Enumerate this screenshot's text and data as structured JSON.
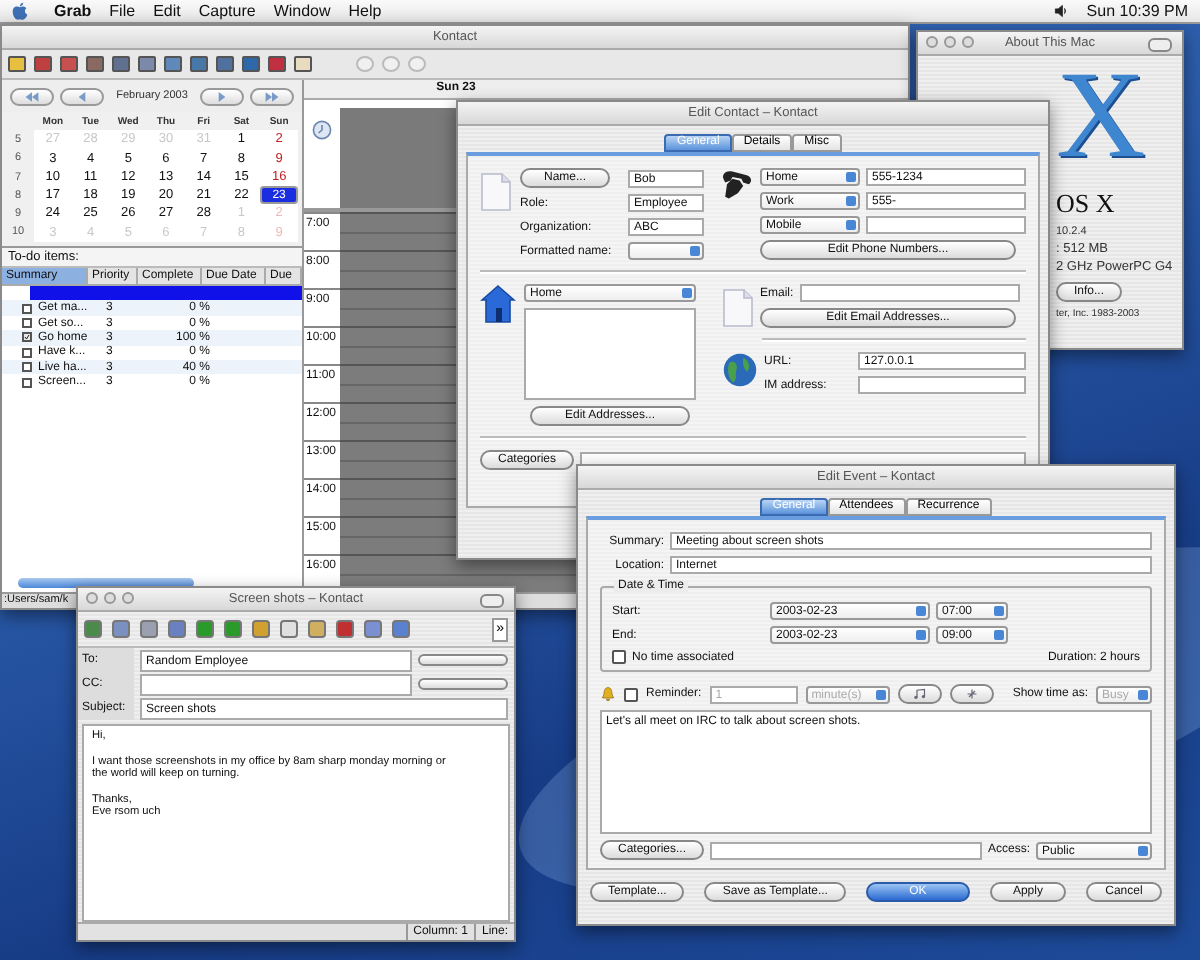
{
  "menubar": {
    "app": "Grab",
    "items": [
      "File",
      "Edit",
      "Capture",
      "Window",
      "Help"
    ],
    "clock": "Sun 10:39 PM"
  },
  "kontact": {
    "title": "Kontact",
    "calendar": {
      "month": "February 2003",
      "weekdays": [
        "Mon",
        "Tue",
        "Wed",
        "Thu",
        "Fri",
        "Sat",
        "Sun"
      ],
      "weeks": [
        {
          "week": "5",
          "days": [
            {
              "n": "27",
              "dim": true,
              "selected": false
            },
            {
              "n": "28",
              "dim": true,
              "selected": false
            },
            {
              "n": "29",
              "dim": true,
              "selected": false
            },
            {
              "n": "30",
              "dim": true,
              "selected": false
            },
            {
              "n": "31",
              "dim": true,
              "selected": false
            },
            {
              "n": "1",
              "dim": false,
              "selected": false
            },
            {
              "n": "2",
              "dim": false,
              "selected": false
            }
          ]
        },
        {
          "week": "6",
          "days": [
            {
              "n": "3",
              "dim": false,
              "selected": false
            },
            {
              "n": "4",
              "dim": false,
              "selected": false
            },
            {
              "n": "5",
              "dim": false,
              "selected": false
            },
            {
              "n": "6",
              "dim": false,
              "selected": false
            },
            {
              "n": "7",
              "dim": false,
              "selected": false
            },
            {
              "n": "8",
              "dim": false,
              "selected": false
            },
            {
              "n": "9",
              "dim": false,
              "selected": false
            }
          ]
        },
        {
          "week": "7",
          "days": [
            {
              "n": "10",
              "dim": false,
              "selected": false
            },
            {
              "n": "11",
              "dim": false,
              "selected": false
            },
            {
              "n": "12",
              "dim": false,
              "selected": false
            },
            {
              "n": "13",
              "dim": false,
              "selected": false
            },
            {
              "n": "14",
              "dim": false,
              "selected": false
            },
            {
              "n": "15",
              "dim": false,
              "selected": false
            },
            {
              "n": "16",
              "dim": false,
              "selected": false
            }
          ]
        },
        {
          "week": "8",
          "days": [
            {
              "n": "17",
              "dim": false,
              "selected": false
            },
            {
              "n": "18",
              "dim": false,
              "selected": false
            },
            {
              "n": "19",
              "dim": false,
              "selected": false
            },
            {
              "n": "20",
              "dim": false,
              "selected": false
            },
            {
              "n": "21",
              "dim": false,
              "selected": false
            },
            {
              "n": "22",
              "dim": false,
              "selected": false
            },
            {
              "n": "23",
              "dim": false,
              "selected": true
            }
          ]
        },
        {
          "week": "9",
          "days": [
            {
              "n": "24",
              "dim": false,
              "selected": false
            },
            {
              "n": "25",
              "dim": false,
              "selected": false
            },
            {
              "n": "26",
              "dim": false,
              "selected": false
            },
            {
              "n": "27",
              "dim": false,
              "selected": false
            },
            {
              "n": "28",
              "dim": false,
              "selected": false
            },
            {
              "n": "1",
              "dim": true,
              "selected": false
            },
            {
              "n": "2",
              "dim": true,
              "selected": false
            }
          ]
        },
        {
          "week": "10",
          "days": [
            {
              "n": "3",
              "dim": true,
              "selected": false
            },
            {
              "n": "4",
              "dim": true,
              "selected": false
            },
            {
              "n": "5",
              "dim": true,
              "selected": false
            },
            {
              "n": "6",
              "dim": true,
              "selected": false
            },
            {
              "n": "7",
              "dim": true,
              "selected": false
            },
            {
              "n": "8",
              "dim": true,
              "selected": false
            },
            {
              "n": "9",
              "dim": true,
              "selected": false
            }
          ]
        }
      ]
    },
    "todo": {
      "title": "To-do items:",
      "columns": [
        "Summary",
        "Priority",
        "Complete",
        "Due Date",
        "Due"
      ],
      "rows": [
        {
          "selected": true
        },
        {
          "selected": false,
          "done": false,
          "summary": "Get ma...",
          "priority": "3",
          "complete": "0 %"
        },
        {
          "selected": false,
          "done": false,
          "summary": "Get so...",
          "priority": "3",
          "complete": "0 %"
        },
        {
          "selected": false,
          "done": true,
          "summary": "Go home",
          "priority": "3",
          "complete": "100 %"
        },
        {
          "selected": false,
          "done": false,
          "summary": "Have k...",
          "priority": "3",
          "complete": "0 %"
        },
        {
          "selected": false,
          "done": false,
          "summary": "Live ha...",
          "priority": "3",
          "complete": "40 %"
        },
        {
          "selected": false,
          "done": false,
          "summary": "Screen...",
          "priority": "3",
          "complete": "0 %"
        }
      ]
    },
    "day": {
      "header": "Sun 23",
      "hours": [
        "7:00",
        "8:00",
        "9:00",
        "10:00",
        "11:00",
        "12:00",
        "13:00",
        "14:00",
        "15:00",
        "16:00"
      ]
    },
    "path": ":Users/sam/k"
  },
  "about": {
    "title": "About This Mac",
    "logo": "X",
    "os": "OS X",
    "version": "10.2.4",
    "memory": ": 512 MB",
    "processor": "2 GHz PowerPC G4",
    "more_info": "Info...",
    "copyright": "ter, Inc. 1983-2003"
  },
  "contact": {
    "title": "Edit Contact – Kontact",
    "tabs": [
      {
        "label": "General",
        "selected": true
      },
      {
        "label": "Details",
        "selected": false
      },
      {
        "label": "Misc",
        "selected": false
      }
    ],
    "name_button": "Name...",
    "name": "Bob",
    "fields": [
      {
        "label": "Role:",
        "value": "Employee"
      },
      {
        "label": "Organization:",
        "value": "ABC"
      }
    ],
    "formatted_name_label": "Formatted name:",
    "phones": [
      {
        "type": "Home",
        "number": "555-1234"
      },
      {
        "type": "Work",
        "number": "555-"
      },
      {
        "type": "Mobile"
      }
    ],
    "edit_phones": "Edit Phone Numbers...",
    "address_type": "Home",
    "edit_addresses": "Edit Addresses...",
    "email_label": "Email:",
    "edit_emails": "Edit Email Addresses...",
    "url_label": "URL:",
    "url": "127.0.0.1",
    "im_label": "IM address:",
    "categories": "Categories"
  },
  "event": {
    "title": "Edit Event – Kontact",
    "tabs": [
      {
        "label": "General",
        "selected": true
      },
      {
        "label": "Attendees",
        "selected": false
      },
      {
        "label": "Recurrence",
        "selected": false
      }
    ],
    "summary_label": "Summary:",
    "summary": "Meeting about screen shots",
    "location_label": "Location:",
    "location": "Internet",
    "group": "Date & Time",
    "start_label": "Start:",
    "start_date": "2003-02-23",
    "start_time": "07:00",
    "end_label": "End:",
    "end_date": "2003-02-23",
    "end_time": "09:00",
    "no_time": {
      "label": "No time associated",
      "checked": false
    },
    "duration": "Duration: 2 hours",
    "reminder": {
      "label": "Reminder:",
      "checked": false,
      "value": "1",
      "unit": "minute(s)"
    },
    "show_time_label": "Show time as:",
    "show_time": "Busy",
    "description": "Let's all meet on IRC to talk about screen shots.",
    "categories": "Categories...",
    "access_label": "Access:",
    "access": "Public",
    "buttons": [
      {
        "label": "Template...",
        "default": false
      },
      {
        "label": "Save as Template...",
        "default": false
      },
      {
        "label": "OK",
        "default": true
      },
      {
        "label": "Apply",
        "default": false
      },
      {
        "label": "Cancel",
        "default": false
      }
    ]
  },
  "composer": {
    "title": "Screen shots – Kontact",
    "more": "»",
    "to_label": "To:",
    "to": "Random Employee",
    "cc_label": "CC:",
    "subject_label": "Subject:",
    "subject": "Screen shots",
    "body": [
      [
        "Hi,"
      ],
      [
        "I want those screenshots in my office by 8am sharp monday morning or",
        "the world will keep on turning."
      ],
      [
        "Thanks,",
        "Eve rsom uch"
      ]
    ],
    "status": [
      "Column: 1",
      "Line:"
    ]
  }
}
